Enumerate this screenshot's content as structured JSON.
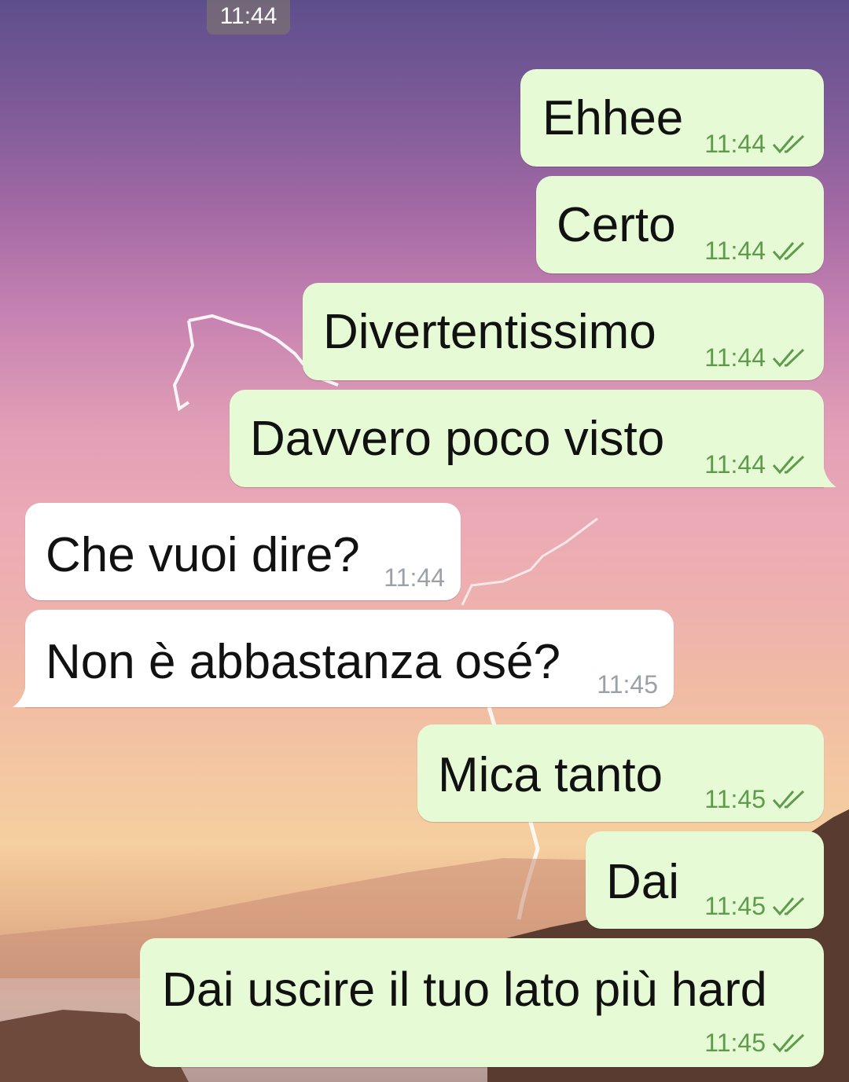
{
  "date_chip": "11:44",
  "messages": [
    {
      "direction": "out",
      "text": "Ehhee",
      "time": "11:44",
      "status": "read"
    },
    {
      "direction": "out",
      "text": "Certo",
      "time": "11:44",
      "status": "read"
    },
    {
      "direction": "out",
      "text": "Divertentissimo",
      "time": "11:44",
      "status": "read"
    },
    {
      "direction": "out",
      "text": "Davvero poco visto",
      "time": "11:44",
      "status": "read"
    },
    {
      "direction": "in",
      "text": "Che vuoi dire?",
      "time": "11:44"
    },
    {
      "direction": "in",
      "text": "Non è abbastanza osé?",
      "time": "11:45"
    },
    {
      "direction": "out",
      "text": "Mica tanto",
      "time": "11:45",
      "status": "read"
    },
    {
      "direction": "out",
      "text": "Dai",
      "time": "11:45",
      "status": "read"
    },
    {
      "direction": "out",
      "text": "Dai uscire il tuo lato più hard",
      "time": "11:45",
      "status": "read"
    }
  ],
  "colors": {
    "outgoing_bubble": "#e6fbd5",
    "incoming_bubble": "#ffffff",
    "read_ticks": "#5e9b4b"
  },
  "icons": {
    "read_status": "double-check-icon"
  }
}
